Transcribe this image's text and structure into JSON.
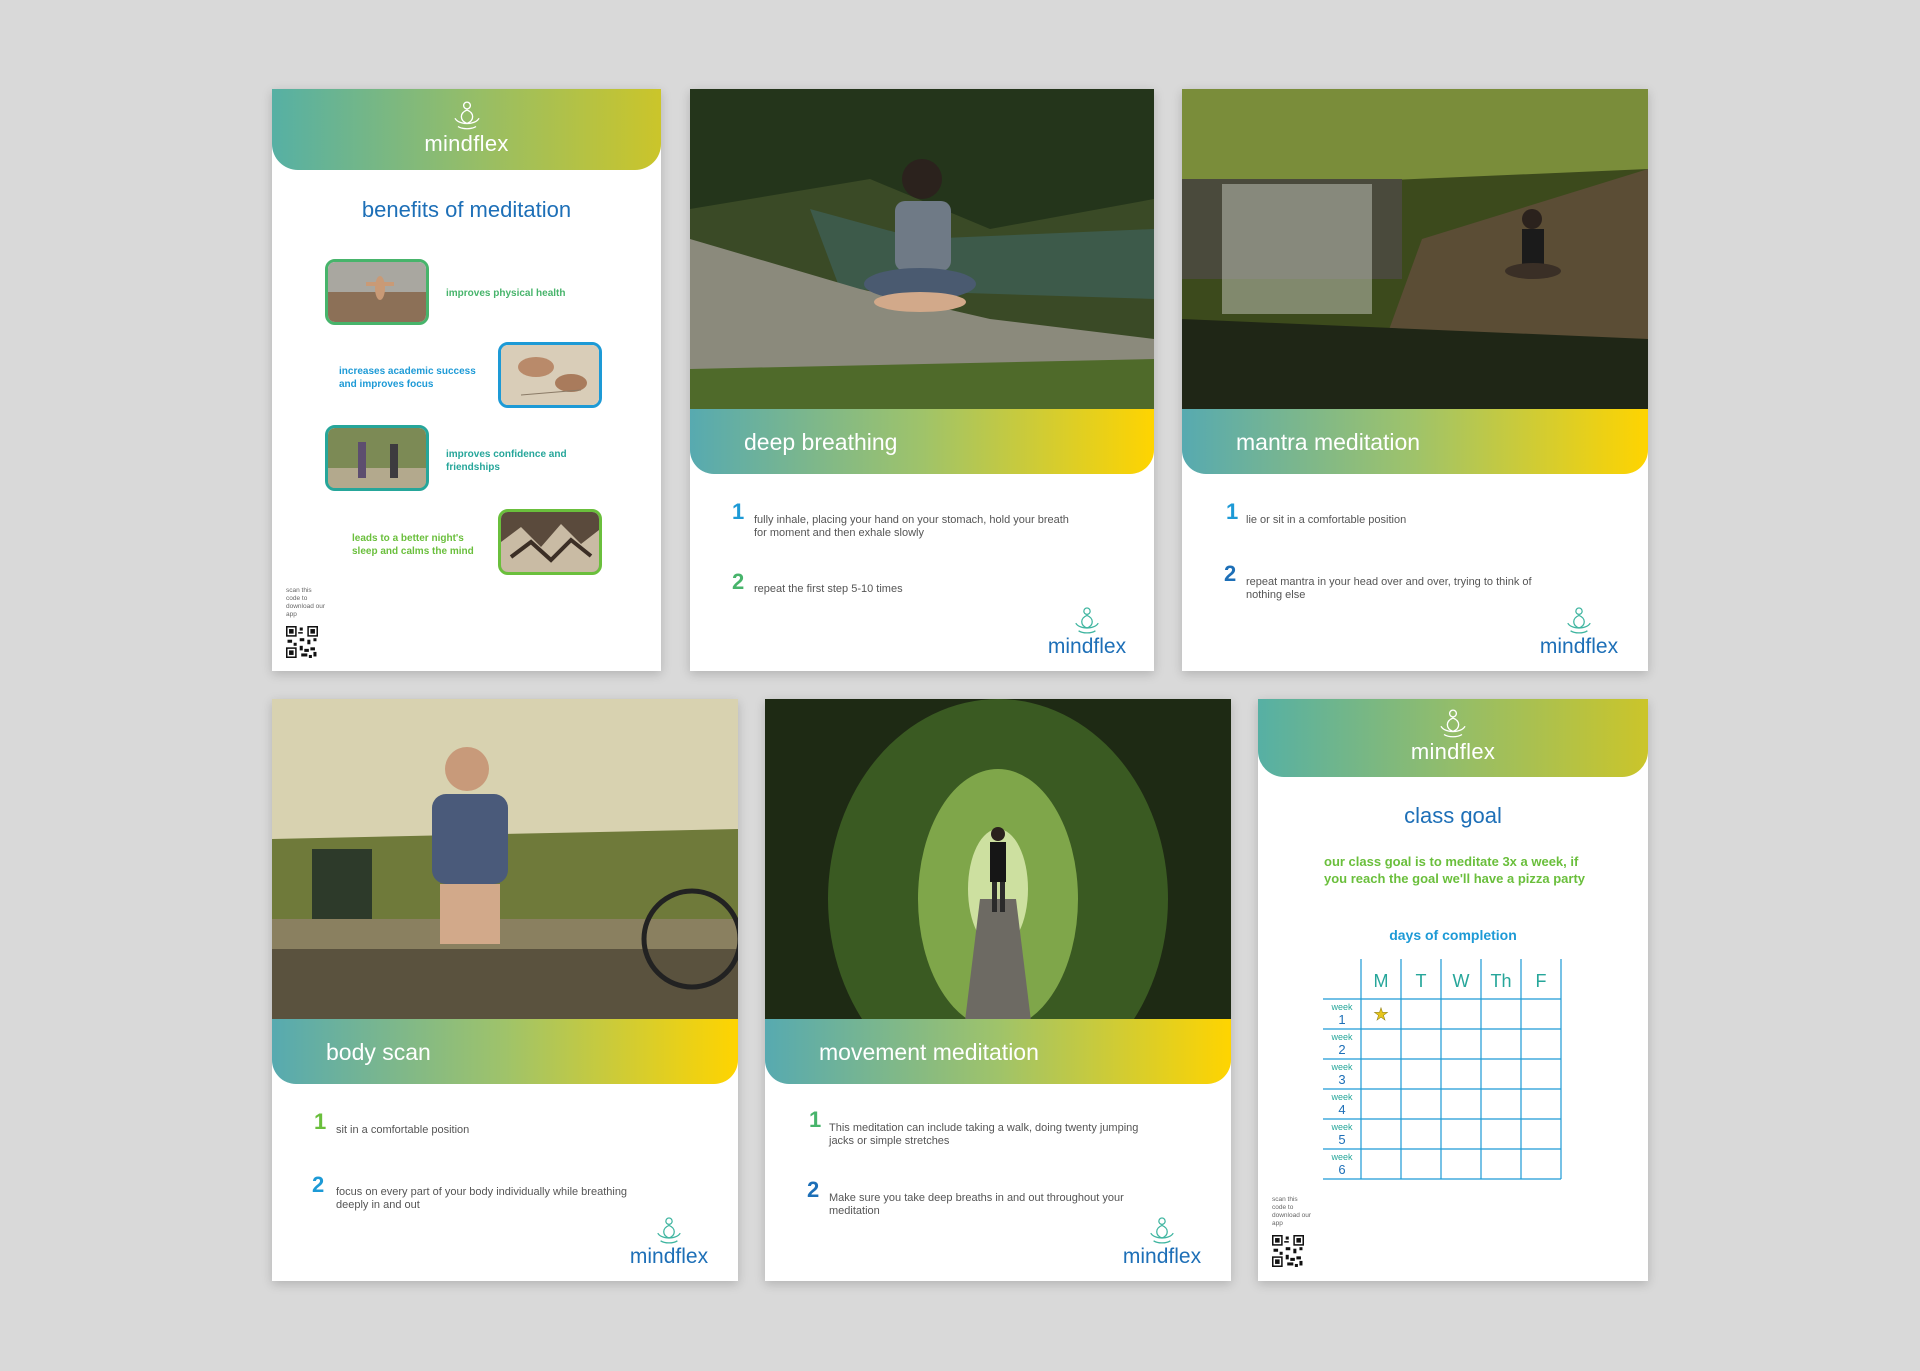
{
  "brand": {
    "name": "mindflex"
  },
  "benefits_card": {
    "title": "benefits of meditation",
    "items": [
      {
        "text": "improves physical health",
        "color": "#47b46b"
      },
      {
        "text": "increases academic success and improves focus",
        "color": "#1d9ad6"
      },
      {
        "text": "improves confidence and friendships",
        "color": "#26a69a"
      },
      {
        "text": "leads to a better night's sleep and calms the mind",
        "color": "#6abf3c"
      }
    ],
    "qr_note": "scan this code to download our app"
  },
  "deep_breathing": {
    "title": "deep breathing",
    "steps": [
      {
        "num": "1",
        "text": "fully inhale, placing your hand on your stomach, hold your breath for moment and then exhale slowly"
      },
      {
        "num": "2",
        "text": "repeat the first step 5-10 times"
      }
    ]
  },
  "mantra_meditation": {
    "title": "mantra meditation",
    "steps": [
      {
        "num": "1",
        "text": "lie or sit in a comfortable position"
      },
      {
        "num": "2",
        "text": "repeat mantra in your head over and over, trying to think of nothing else"
      }
    ]
  },
  "body_scan": {
    "title": "body scan",
    "steps": [
      {
        "num": "1",
        "text": "sit in a comfortable position"
      },
      {
        "num": "2",
        "text": "focus on every part of your body individually while breathing deeply in and out"
      }
    ]
  },
  "movement_meditation": {
    "title": "movement meditation",
    "steps": [
      {
        "num": "1",
        "text": "This meditation can include taking a walk, doing twenty jumping jacks or simple stretches"
      },
      {
        "num": "2",
        "text": "Make sure you take deep breaths in and out throughout your meditation"
      }
    ]
  },
  "class_goal": {
    "title": "class goal",
    "goal_text": "our class goal is to meditate 3x a week, if you reach the goal we'll have a pizza party",
    "days_title": "days of completion",
    "days": [
      "M",
      "T",
      "W",
      "Th",
      "F"
    ],
    "weeks": [
      {
        "label": "week",
        "num": "1"
      },
      {
        "label": "week",
        "num": "2"
      },
      {
        "label": "week",
        "num": "3"
      },
      {
        "label": "week",
        "num": "4"
      },
      {
        "label": "week",
        "num": "5"
      },
      {
        "label": "week",
        "num": "6"
      }
    ],
    "completed": [
      {
        "week": 1,
        "day": "M",
        "mark": "star"
      }
    ],
    "qr_note": "scan this code to download our app"
  },
  "colors": {
    "brand_blue": "#1d6fb7",
    "green": "#47b46b",
    "light_blue": "#1d9ad6",
    "lime": "#6abf3c",
    "yellow": "#ffd400",
    "grid_blue": "#1d9ad6",
    "star": "#e6c51e"
  }
}
